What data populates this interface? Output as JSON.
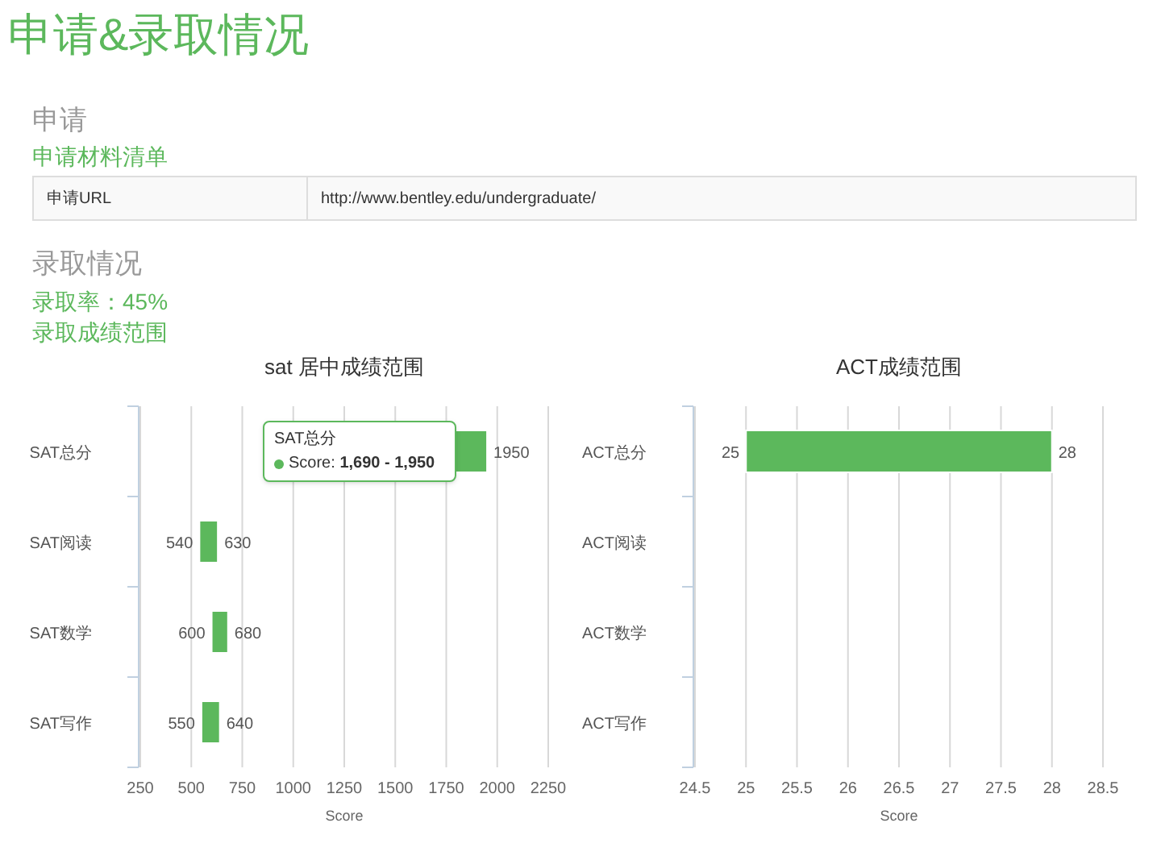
{
  "page_title": "申请&录取情况",
  "application": {
    "heading": "申请",
    "subheading": "申请材料清单",
    "table": {
      "rows": [
        {
          "label": "申请URL",
          "value": "http://www.bentley.edu/undergraduate/"
        }
      ]
    }
  },
  "admission": {
    "heading": "录取情况",
    "rate": "录取率：45%",
    "subheading": "录取成绩范围"
  },
  "charts": [
    {
      "title": "sat 居中成绩范围",
      "xlabel": "Score",
      "xticks": [
        "250",
        "500",
        "750",
        "1000",
        "1250",
        "1500",
        "1750",
        "2000",
        "2250"
      ],
      "rows": [
        {
          "label": "SAT总分",
          "high": "1950"
        },
        {
          "label": "SAT阅读",
          "low": "540",
          "high": "630"
        },
        {
          "label": "SAT数学",
          "low": "600",
          "high": "680"
        },
        {
          "label": "SAT写作",
          "low": "550",
          "high": "640"
        }
      ],
      "tooltip": {
        "title": "SAT总分",
        "text": "Score: **1,690 - 1,950**"
      }
    },
    {
      "title": "ACT成绩范围",
      "xlabel": "Score",
      "xticks": [
        "24.5",
        "25",
        "25.5",
        "26",
        "26.5",
        "27",
        "27.5",
        "28",
        "28.5"
      ],
      "rows": [
        {
          "label": "ACT总分",
          "low": "25",
          "high": "28"
        },
        {
          "label": "ACT阅读"
        },
        {
          "label": "ACT数学"
        },
        {
          "label": "ACT写作"
        }
      ]
    }
  ]
}
